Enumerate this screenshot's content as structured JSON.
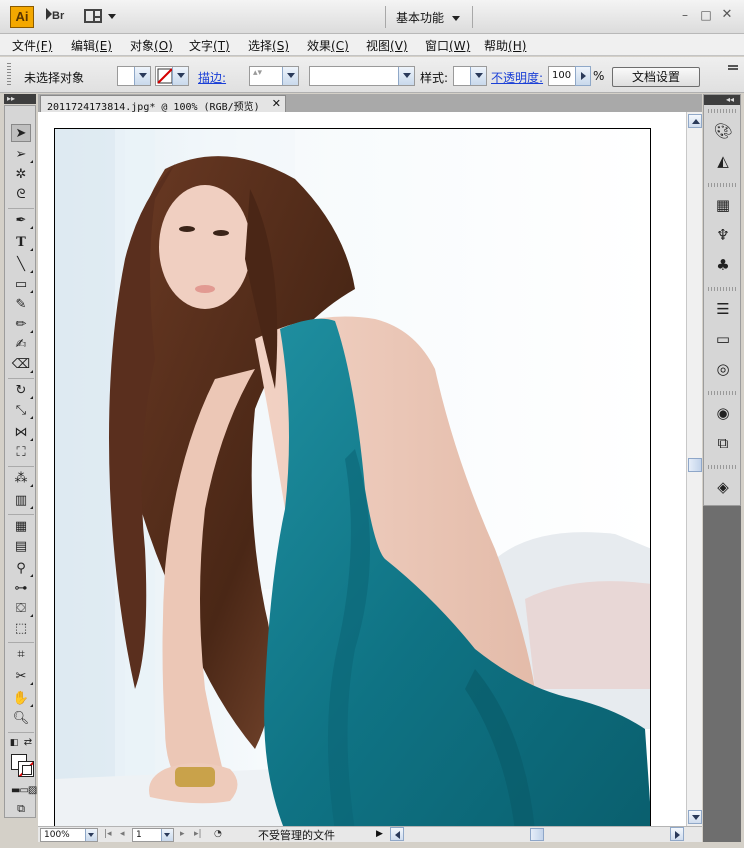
{
  "app": {
    "logo_text": "Ai",
    "bridge_label": "Br",
    "workspace_label": "基本功能",
    "window_controls": [
      "minimize",
      "maximize",
      "close"
    ]
  },
  "menu": {
    "items": [
      {
        "label": "文件",
        "key": "(F)"
      },
      {
        "label": "编辑",
        "key": "(E)"
      },
      {
        "label": "对象",
        "key": "(O)"
      },
      {
        "label": "文字",
        "key": "(T)"
      },
      {
        "label": "选择",
        "key": "(S)"
      },
      {
        "label": "效果",
        "key": "(C)"
      },
      {
        "label": "视图",
        "key": "(V)"
      },
      {
        "label": "窗口",
        "key": "(W)"
      },
      {
        "label": "帮助",
        "key": "(H)"
      }
    ]
  },
  "control": {
    "selection_label": "未选择对象",
    "stroke_label": "描边:",
    "style_label": "样式:",
    "opacity_label": "不透明度:",
    "opacity_value": "100",
    "opacity_unit": "%",
    "doc_settings_button": "文档设置"
  },
  "document": {
    "tab_title": "2011724173814.jpg* @ 100% (RGB/预览)",
    "close_glyph": "✕"
  },
  "status": {
    "zoom_value": "100%",
    "page_value": "1",
    "info_text": "不受管理的文件"
  },
  "colors": {
    "dress": "#117d8e",
    "hair": "#5a2f1e",
    "skin": "#e9c4b4",
    "accent_link": "#1a3fd6"
  }
}
